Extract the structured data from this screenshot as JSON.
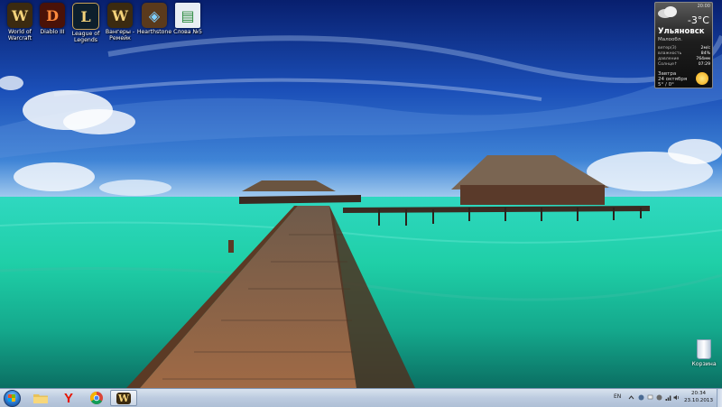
{
  "desktop_icons": [
    {
      "label": "World of Warcraft",
      "name": "world-of-warcraft-shortcut",
      "glyph": "W",
      "bg": "#3b2a10"
    },
    {
      "label": "Diablo III",
      "name": "diablo-iii-shortcut",
      "glyph": "D",
      "bg": "#4a1208"
    },
    {
      "label": "League of Legends",
      "name": "league-of-legends-shortcut",
      "glyph": "L",
      "bg": "#0d1f2c"
    },
    {
      "label": "Вангеры - Ремейк",
      "name": "vangers-remake-shortcut",
      "glyph": "W",
      "bg": "#3b2a10"
    },
    {
      "label": "Hearthstone",
      "name": "hearthstone-shortcut",
      "glyph": "◈",
      "bg": "#5a3a1c"
    },
    {
      "label": "Слова №5",
      "name": "slova-n5-document",
      "glyph": "▤",
      "bg": "#e8eef3"
    }
  ],
  "weather": {
    "time": "20:00",
    "temperature": "-3°C",
    "city": "Ульяновск",
    "region": "Малообл.",
    "rows": [
      {
        "label": "ветер(З)",
        "value": "2м/с"
      },
      {
        "label": "влажность",
        "value": "84%"
      },
      {
        "label": "давление",
        "value": "764мм"
      },
      {
        "label": "Солнце↑",
        "value": "07:29"
      }
    ],
    "tomorrow_label": "Завтра",
    "tomorrow_date": "24 октября",
    "tomorrow_temp": "5° / 0°"
  },
  "recycle_bin": {
    "label": "Корзина"
  },
  "taskbar": {
    "pinned": [
      {
        "name": "explorer-taskbar-button",
        "icon": "folder-icon"
      },
      {
        "name": "yandex-browser-taskbar-button",
        "icon": "yandex-icon"
      },
      {
        "name": "chrome-taskbar-button",
        "icon": "chrome-icon"
      },
      {
        "name": "world-of-warcraft-taskbar-button",
        "icon": "wow-icon",
        "active": true
      }
    ],
    "language": "EN",
    "time": "20:34",
    "date": "23.10.2013"
  },
  "colors": {
    "taskbar": "#c9d5e5",
    "accent": "#2e7fd6"
  }
}
